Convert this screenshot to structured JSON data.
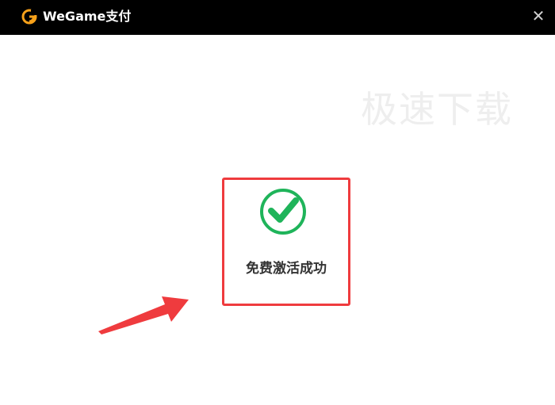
{
  "window": {
    "title": "WeGame支付",
    "close_icon": "close-icon",
    "logo_icon": "wegame-logo-icon"
  },
  "watermark": {
    "text": "极速下载"
  },
  "status": {
    "message": "免费激活成功",
    "icon": "check-circle-icon"
  },
  "annotation": {
    "arrow_icon": "red-arrow-icon"
  },
  "colors": {
    "titlebar_bg": "#000000",
    "title_text": "#ffffff",
    "accent_red": "#ef3b3e",
    "success_green": "#1fb45a",
    "text_dark": "#333333",
    "logo_orange": "#f7a11a"
  }
}
